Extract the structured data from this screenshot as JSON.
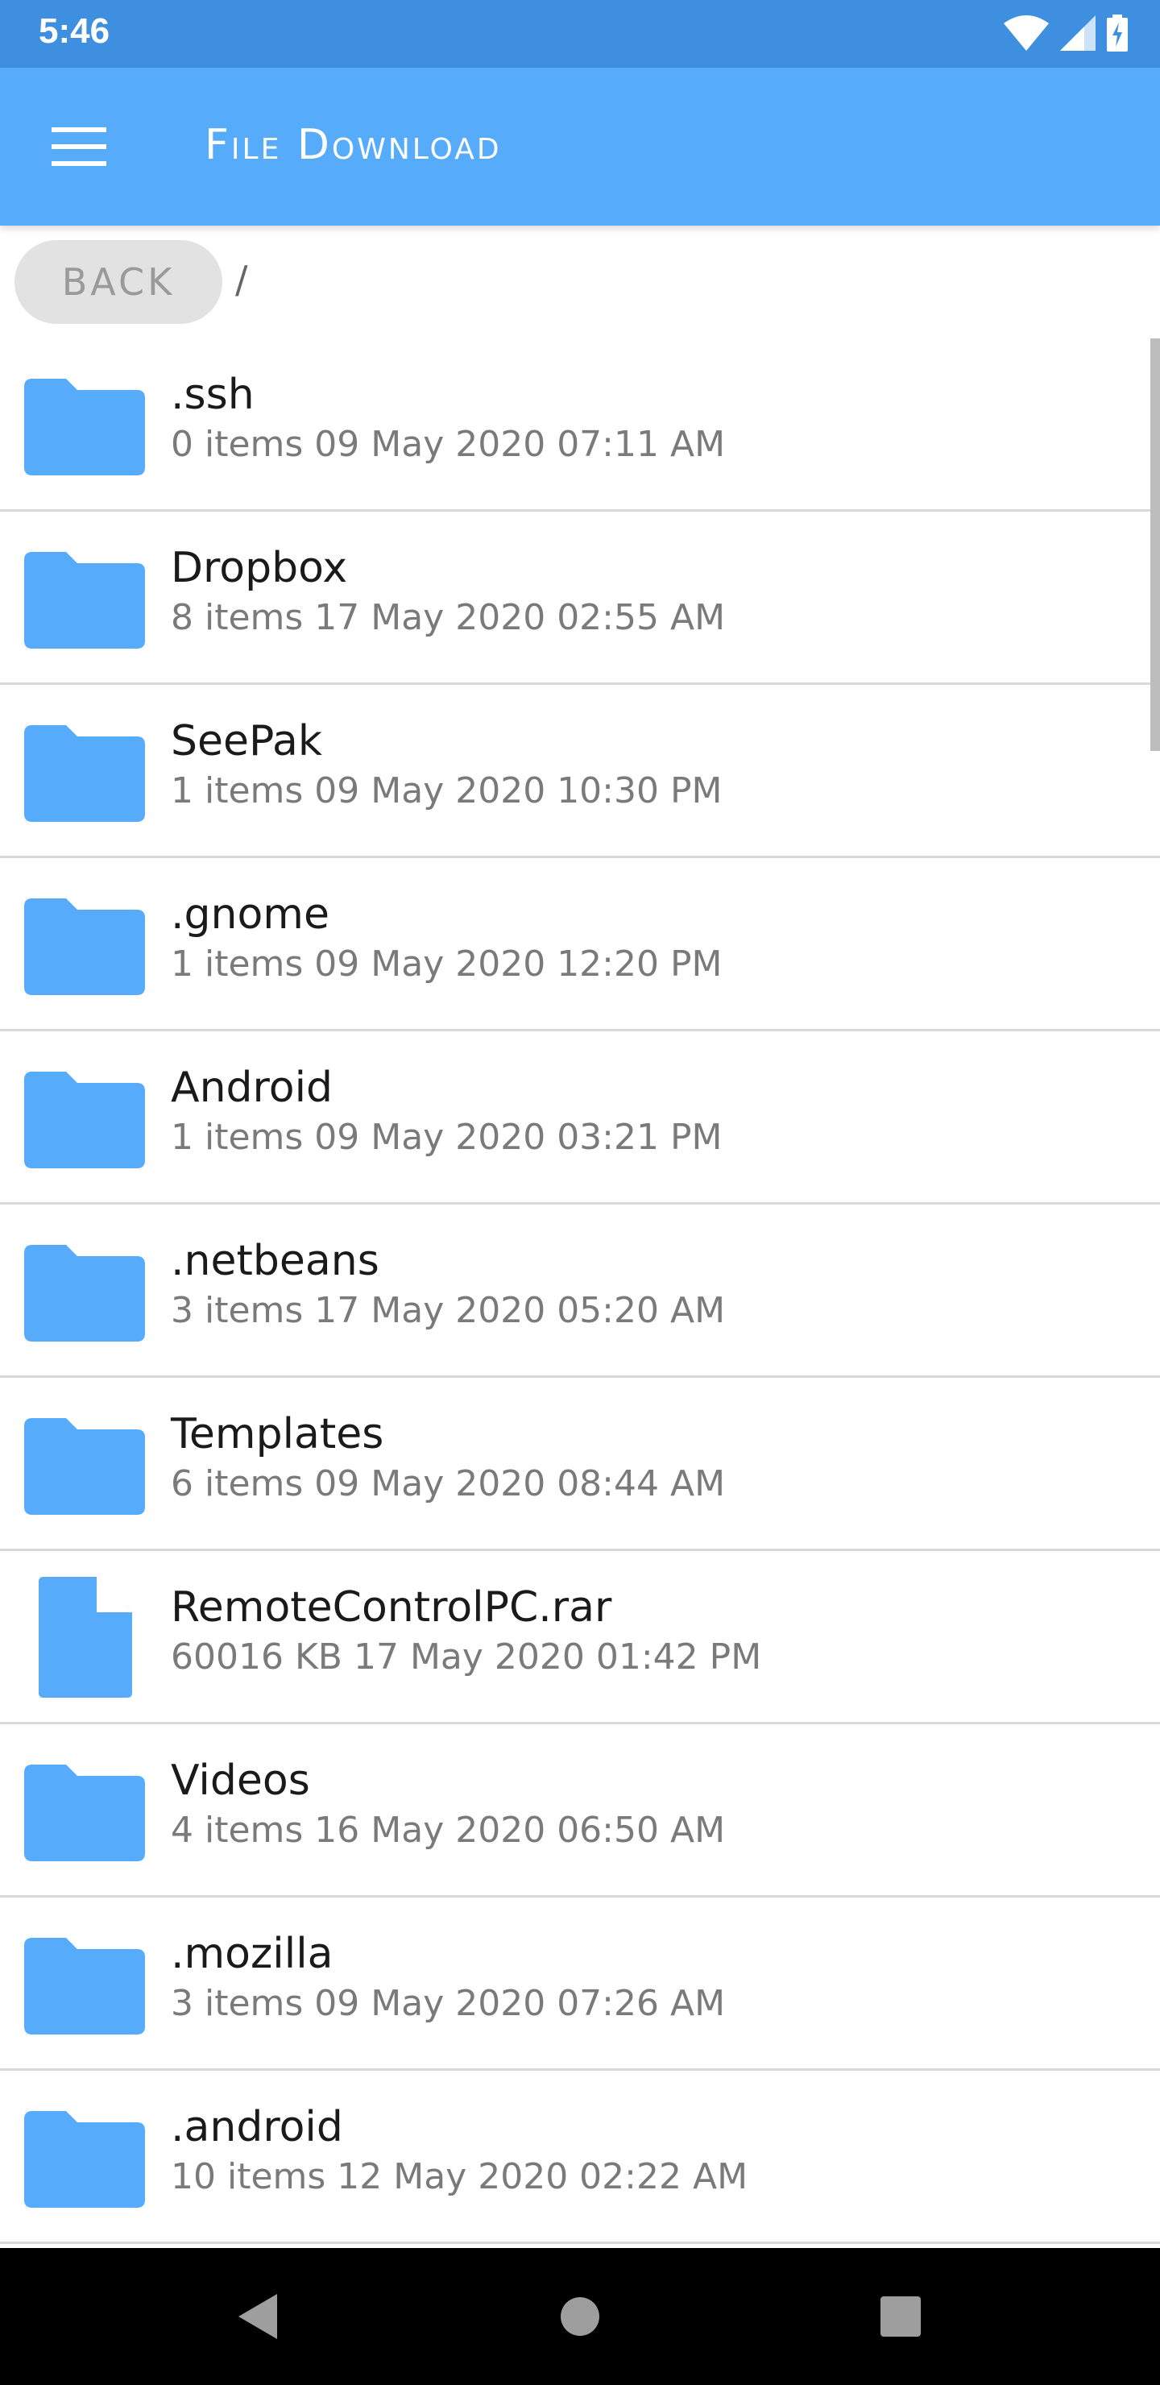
{
  "status_bar": {
    "time": "5:46",
    "icons": [
      "wifi-icon",
      "cell-signal-icon",
      "battery-charging-icon"
    ]
  },
  "app_bar": {
    "menu_icon": "hamburger-menu-icon",
    "title": "File Download",
    "color": "#56abfa"
  },
  "path_bar": {
    "back_label": "BACK",
    "path": "/"
  },
  "files": [
    {
      "name": ".ssh",
      "meta": "0 items 09 May 2020 07:11 AM",
      "type": "folder"
    },
    {
      "name": "Dropbox",
      "meta": "8 items 17 May 2020 02:55 AM",
      "type": "folder"
    },
    {
      "name": "SeePak",
      "meta": "1 items 09 May 2020 10:30 PM",
      "type": "folder"
    },
    {
      "name": ".gnome",
      "meta": "1 items 09 May 2020 12:20 PM",
      "type": "folder"
    },
    {
      "name": "Android",
      "meta": "1 items 09 May 2020 03:21 PM",
      "type": "folder"
    },
    {
      "name": ".netbeans",
      "meta": "3 items 17 May 2020 05:20 AM",
      "type": "folder"
    },
    {
      "name": "Templates",
      "meta": "6 items 09 May 2020 08:44 AM",
      "type": "folder"
    },
    {
      "name": "RemoteControlPC.rar",
      "meta": "60016 KB 17 May 2020 01:42 PM",
      "type": "file"
    },
    {
      "name": "Videos",
      "meta": "4 items 16 May 2020 06:50 AM",
      "type": "folder"
    },
    {
      "name": ".mozilla",
      "meta": "3 items 09 May 2020 07:26 AM",
      "type": "folder"
    },
    {
      "name": ".android",
      "meta": "10 items 12 May 2020 02:22 AM",
      "type": "folder"
    }
  ],
  "nav_bar": {
    "back": "nav-back-icon",
    "home": "nav-home-icon",
    "recents": "nav-recents-icon"
  },
  "colors": {
    "status_bar": "#3f8fe0",
    "icon_blue": "#56abfa",
    "divider": "#d9d9d9"
  }
}
